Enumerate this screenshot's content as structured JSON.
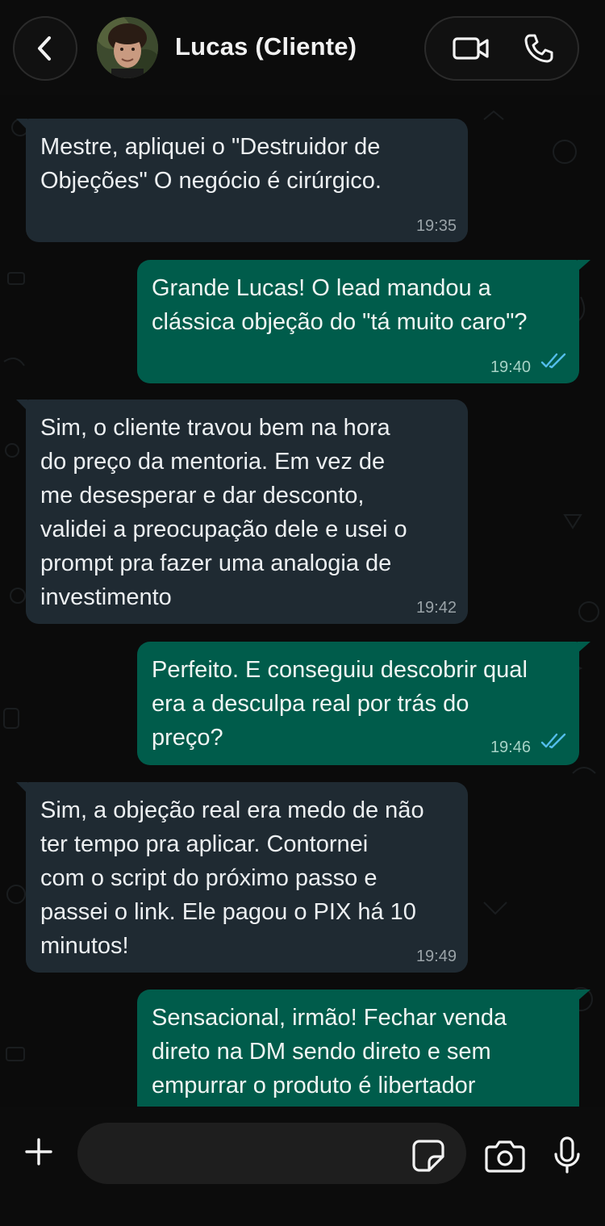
{
  "header": {
    "contact_name": "Lucas (Cliente)",
    "back_icon": "chevron-left-icon",
    "video_icon": "video-camera-icon",
    "voice_icon": "phone-icon"
  },
  "messages": [
    {
      "direction": "in",
      "text": "Mestre, apliquei o \"Destruidor de\nObjeções\" O negócio é cirúrgico.",
      "time": "19:35"
    },
    {
      "direction": "out",
      "text": "Grande Lucas! O lead mandou a\nclássica objeção do \"tá muito caro\"?",
      "time": "19:40",
      "status": "read"
    },
    {
      "direction": "in",
      "text": "Sim, o cliente travou bem na hora\ndo preço da mentoria. Em vez de\nme desesperar e dar desconto,\nvalidei a preocupação dele e usei o\nprompt pra fazer uma analogia de\ninvestimento",
      "time": "19:42"
    },
    {
      "direction": "out",
      "text": "Perfeito. E conseguiu descobrir qual\nera a desculpa real por trás do\npreço?",
      "time": "19:46",
      "status": "read"
    },
    {
      "direction": "in",
      "text": "Sim, a objeção real era medo de não\nter tempo pra aplicar. Contornei\ncom o script do próximo passo e\npassei o link. Ele pagou o PIX há 10\nminutos!",
      "time": "19:49"
    },
    {
      "direction": "out",
      "text": "Sensacional, irmão! Fechar venda\ndireto na DM sendo direto e sem\nempurrar o produto é libertador",
      "time": "",
      "status": "read"
    }
  ],
  "composer": {
    "placeholder": "",
    "value": "",
    "plus_icon": "plus-icon",
    "sticker_icon": "sticker-icon",
    "camera_icon": "camera-icon",
    "mic_icon": "microphone-icon"
  },
  "colors": {
    "incoming_bubble": "#1f2a32",
    "outgoing_bubble": "#005c4b",
    "read_ticks": "#53bdeb",
    "background": "#0b0b0b"
  }
}
